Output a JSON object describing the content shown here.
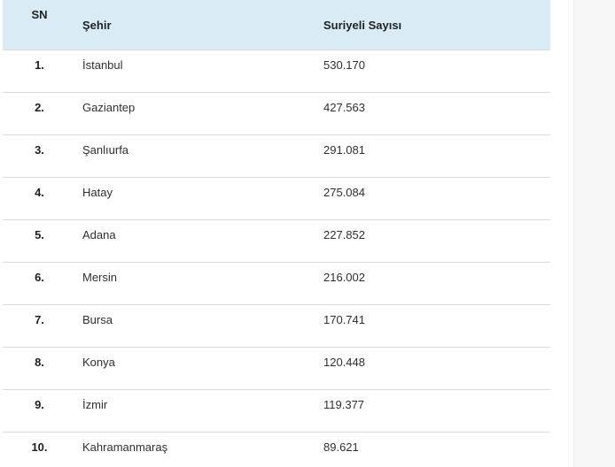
{
  "table": {
    "headers": {
      "sn": "SN",
      "city": "Şehir",
      "count": "Suriyeli Sayısı"
    },
    "rows": [
      {
        "sn": "1.",
        "city": "İstanbul",
        "count": "530.170"
      },
      {
        "sn": "2.",
        "city": "Gaziantep",
        "count": "427.563"
      },
      {
        "sn": "3.",
        "city": "Şanlıurfa",
        "count": "291.081"
      },
      {
        "sn": "4.",
        "city": "Hatay",
        "count": "275.084"
      },
      {
        "sn": "5.",
        "city": "Adana",
        "count": "227.852"
      },
      {
        "sn": "6.",
        "city": "Mersin",
        "count": "216.002"
      },
      {
        "sn": "7.",
        "city": "Bursa",
        "count": "170.741"
      },
      {
        "sn": "8.",
        "city": "Konya",
        "count": "120.448"
      },
      {
        "sn": "9.",
        "city": "İzmir",
        "count": "119.377"
      },
      {
        "sn": "10.",
        "city": "Kahramanmaraş",
        "count": "89.621"
      }
    ]
  },
  "colors": {
    "header_background": "#d9ecf6",
    "row_divider": "#d8dde2",
    "gutter_background": "#f7f7f8"
  }
}
